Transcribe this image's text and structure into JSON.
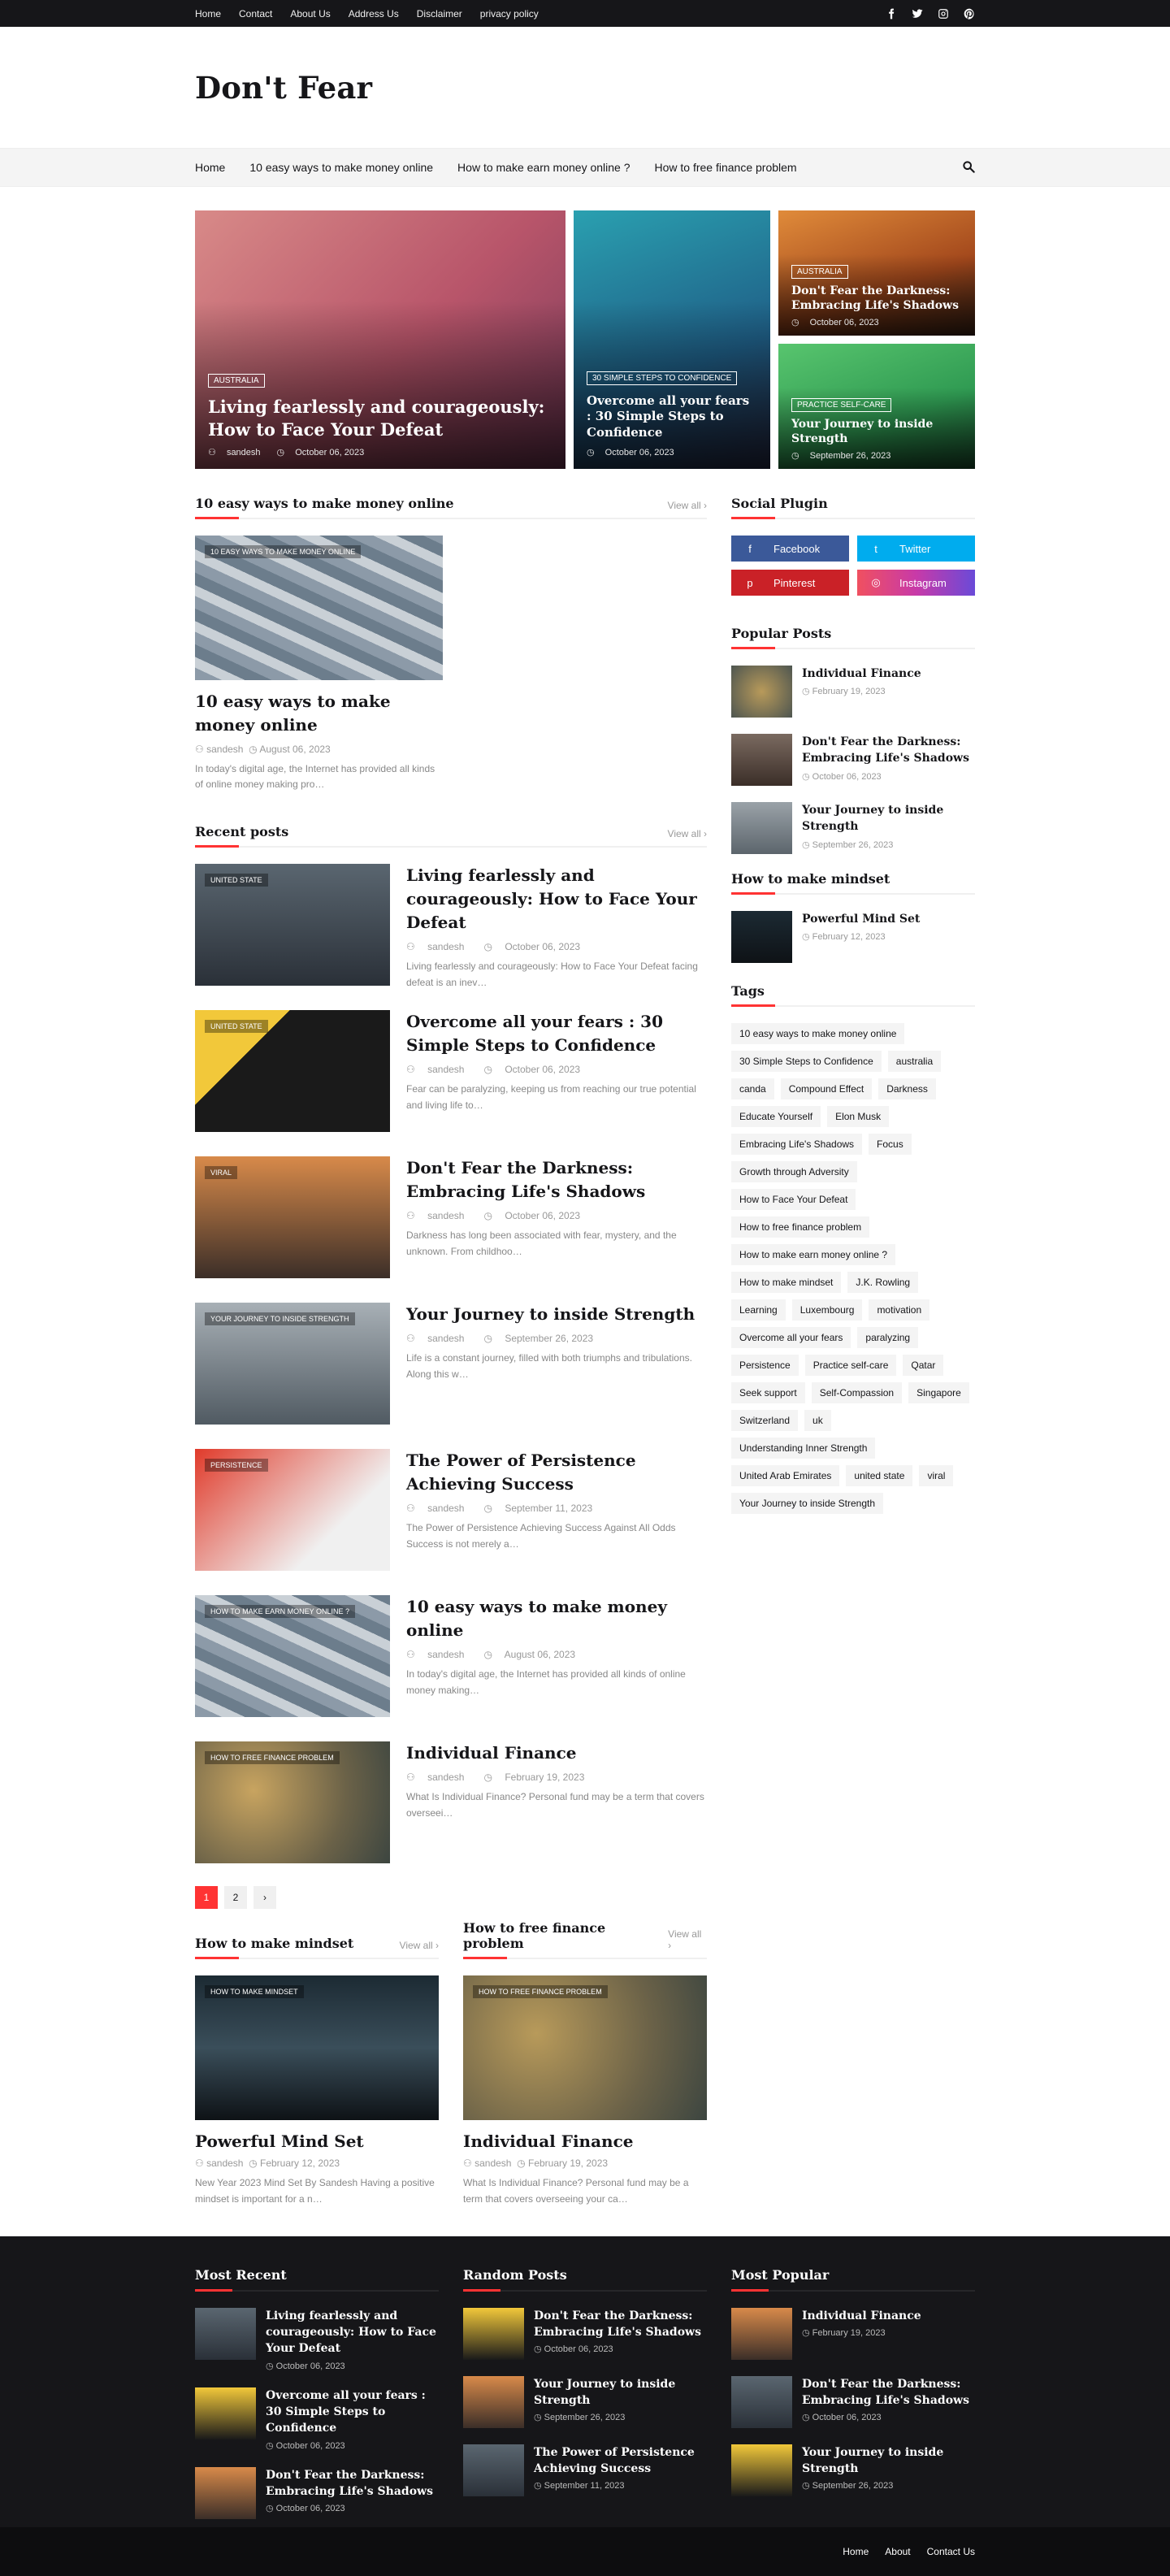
{
  "topbar": {
    "links": [
      "Home",
      "Contact",
      "About Us",
      "Address Us",
      "Disclaimer",
      "privacy policy"
    ],
    "social": [
      "facebook-icon",
      "twitter-icon",
      "instagram-icon",
      "pinterest-icon"
    ]
  },
  "header": {
    "logo": "Don't Fear"
  },
  "nav": {
    "items": [
      "Home",
      "10 easy ways to make money online",
      "How to make earn money online ?",
      "How to free finance problem"
    ],
    "search_icon": "search-icon"
  },
  "featured": [
    {
      "badge": "AUSTRALIA",
      "title": "Living fearlessly and courageously: How to Face Your Defeat",
      "author": "sandesh",
      "date": "October 06, 2023",
      "color": "#c0656a"
    },
    {
      "badge": "30 SIMPLE STEPS TO CONFIDENCE",
      "title": "Overcome all your fears : 30 Simple Steps to Confidence",
      "date": "October 06, 2023",
      "color": "#2f8a9c"
    },
    {
      "badge": "AUSTRALIA",
      "title": "Don't Fear the Darkness: Embracing Life's Shadows",
      "date": "October 06, 2023",
      "color": "#c26a2c"
    },
    {
      "badge": "PRACTICE SELF-CARE",
      "title": "Your Journey to inside Strength",
      "date": "September 26, 2023",
      "color": "#3aa760"
    }
  ],
  "section1": {
    "title": "10 easy ways to make money online",
    "view_all": "View all ›",
    "post": {
      "badge": "10 EASY WAYS TO MAKE MONEY ONLINE",
      "title": "10 easy ways to make money online",
      "author": "sandesh",
      "date": "August 06, 2023",
      "excerpt": "In today's digital age, the Internet has provided all kinds of online money making pro…"
    }
  },
  "recent": {
    "title": "Recent posts",
    "view_all": "View all ›",
    "posts": [
      {
        "badge": "UNITED STATE",
        "title": "Living fearlessly and courageously: How to Face Your Defeat",
        "author": "sandesh",
        "date": "October 06, 2023",
        "excerpt": "Living fearlessly and courageously:  How to Face Your Defeat  facing defeat is an inev…",
        "color": "#4a5560"
      },
      {
        "badge": "UNITED STATE",
        "title": "Overcome all your fears : 30 Simple Steps to Confidence",
        "author": "sandesh",
        "date": "October 06, 2023",
        "excerpt": "Fear can be paralyzing, keeping us from reaching our true potential and living life to…",
        "color": "#2a2320"
      },
      {
        "badge": "VIRAL",
        "title": "Don't Fear the Darkness: Embracing Life's Shadows",
        "author": "sandesh",
        "date": "October 06, 2023",
        "excerpt": "Darkness has long been associated with fear, mystery, and the unknown. From childhoo…",
        "color": "#6b5a50"
      },
      {
        "badge": "YOUR JOURNEY TO INSIDE STRENGTH",
        "title": "Your Journey to inside Strength",
        "author": "sandesh",
        "date": "September 26, 2023",
        "excerpt": "Life is a constant journey, filled with both triumphs and tribulations. Along this w…",
        "color": "#8f969c"
      },
      {
        "badge": "PERSISTENCE",
        "title": "The Power of Persistence Achieving Success",
        "author": "sandesh",
        "date": "September 11, 2023",
        "excerpt": "The Power of Persistence Achieving Success Against All Odds Success is not merely a…",
        "color": "#c8372a"
      },
      {
        "badge": "HOW TO MAKE EARN MONEY ONLINE ?",
        "title": "10 easy ways to make money online",
        "author": "sandesh",
        "date": "August 06, 2023",
        "excerpt": "In today's digital age, the Internet has provided all kinds of online money making…",
        "color": "#7f8a96"
      },
      {
        "badge": "HOW TO FREE FINANCE PROBLEM",
        "title": "Individual Finance",
        "author": "sandesh",
        "date": "February 19, 2023",
        "excerpt": "What Is  Individual  Finance?  Personal  fund   may be a  term that covers  overseei…",
        "color": "#6e6652"
      }
    ]
  },
  "pager": [
    "1",
    "2",
    "›"
  ],
  "mindset": {
    "title": "How to make mindset",
    "view_all": "View all ›",
    "post": {
      "badge": "HOW TO MAKE MINDSET",
      "title": "Powerful Mind Set",
      "author": "sandesh",
      "date": "February 12, 2023",
      "excerpt": "New Year 2023 Mind Set By Sandesh   Having a positive mindset is important for a n…"
    }
  },
  "finance": {
    "title": "How to free finance problem",
    "view_all": "View all ›",
    "post": {
      "badge": "HOW TO FREE FINANCE PROBLEM",
      "title": "Individual Finance",
      "author": "sandesh",
      "date": "February 19, 2023",
      "excerpt": "What Is Individual Finance? Personal fund may be a term that covers overseeing your ca…"
    }
  },
  "sidebar": {
    "social_title": "Social Plugin",
    "social": [
      {
        "label": "Facebook",
        "icon": "f",
        "color": "#3b5999"
      },
      {
        "label": "Twitter",
        "icon": "t",
        "color": "#00acee"
      },
      {
        "label": "Pinterest",
        "icon": "p",
        "color": "#ca2127"
      },
      {
        "label": "Instagram",
        "icon": "i",
        "color": "#d6249f"
      }
    ],
    "popular_title": "Popular Posts",
    "popular": [
      {
        "title": "Individual Finance",
        "date": "February 19, 2023"
      },
      {
        "title": "Don't Fear the Darkness: Embracing Life's Shadows",
        "date": "October 06, 2023"
      },
      {
        "title": "Your Journey to inside Strength",
        "date": "September 26, 2023"
      }
    ],
    "mindset_title": "How to make mindset",
    "mindset": [
      {
        "title": "Powerful Mind Set",
        "date": "February 12, 2023"
      }
    ],
    "tags_title": "Tags",
    "tags": [
      "10 easy ways to make money online",
      "30 Simple Steps to Confidence",
      "australia",
      "canda",
      "Compound Effect",
      "Darkness",
      "Educate Yourself",
      "Elon Musk",
      "Embracing Life's Shadows",
      "Focus",
      "Growth through Adversity",
      "How to Face Your Defeat",
      "How to free finance problem",
      "How to make earn money online ?",
      "How to make mindset",
      "J.K. Rowling",
      "Learning",
      "Luxembourg",
      "motivation",
      "Overcome all your fears",
      "paralyzing",
      "Persistence",
      "Practice self-care",
      "Qatar",
      "Seek support",
      "Self-Compassion",
      "Singapore",
      "Switzerland",
      "uk",
      "Understanding Inner Strength",
      "United Arab Emirates",
      "united state",
      "viral",
      "Your Journey to inside Strength"
    ]
  },
  "footer": {
    "cols": [
      {
        "title": "Most Recent",
        "posts": [
          {
            "title": "Living fearlessly and courageously: How to Face Your Defeat",
            "date": "October 06, 2023"
          },
          {
            "title": "Overcome all your fears : 30 Simple Steps to Confidence",
            "date": "October 06, 2023"
          },
          {
            "title": "Don't Fear the Darkness: Embracing Life's Shadows",
            "date": "October 06, 2023"
          }
        ]
      },
      {
        "title": "Random Posts",
        "posts": [
          {
            "title": "Don't Fear the Darkness: Embracing Life's Shadows",
            "date": "October 06, 2023"
          },
          {
            "title": "Your Journey to inside Strength",
            "date": "September 26, 2023"
          },
          {
            "title": "The Power of Persistence Achieving Success",
            "date": "September 11, 2023"
          }
        ]
      },
      {
        "title": "Most Popular",
        "posts": [
          {
            "title": "Individual Finance",
            "date": "February 19, 2023"
          },
          {
            "title": "Don't Fear the Darkness: Embracing Life's Shadows",
            "date": "October 06, 2023"
          },
          {
            "title": "Your Journey to inside Strength",
            "date": "September 26, 2023"
          }
        ]
      }
    ],
    "bottom_links": [
      "Home",
      "About",
      "Contact Us"
    ]
  },
  "glyphs": {
    "user": "⚇",
    "clock": "◷"
  },
  "accent": "#ff3333"
}
